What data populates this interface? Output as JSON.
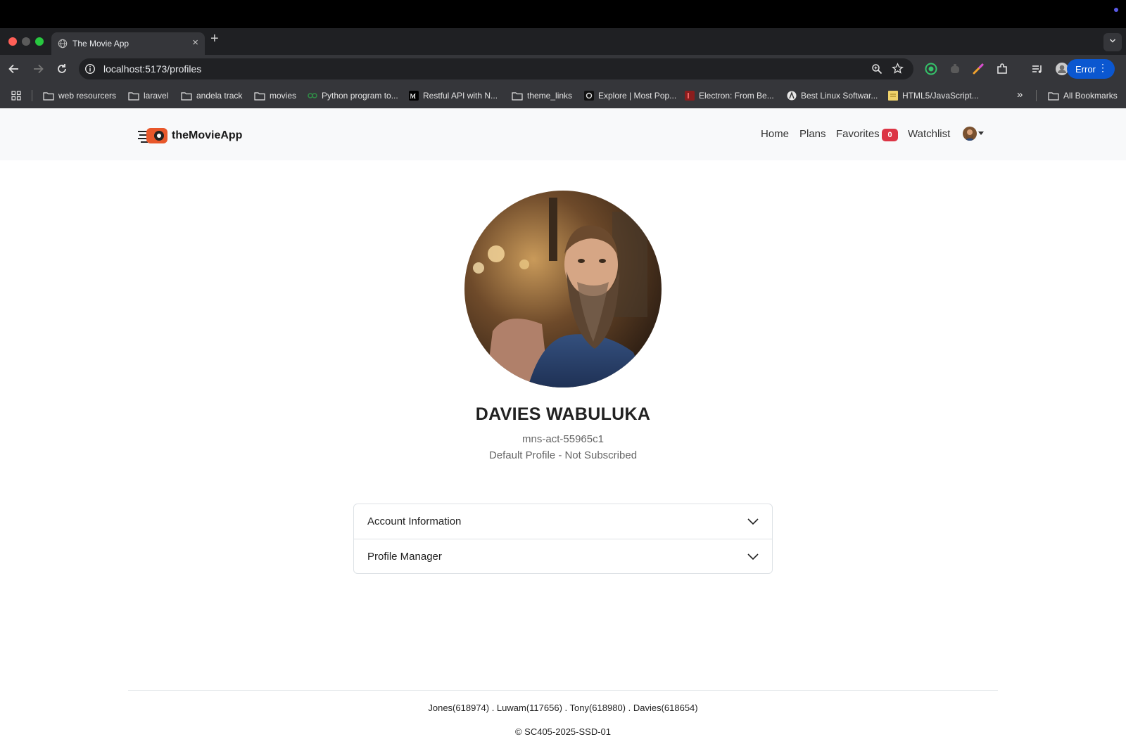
{
  "browser": {
    "tab_title": "The Movie App",
    "new_tab_label": "+",
    "url": "localhost:5173/profiles",
    "error_label": "Error",
    "bookmarks": [
      {
        "label": "web resourcers",
        "icon": "folder-icon"
      },
      {
        "label": "laravel",
        "icon": "folder-icon"
      },
      {
        "label": "andela track",
        "icon": "folder-icon"
      },
      {
        "label": "movies",
        "icon": "folder-icon"
      },
      {
        "label": "Python program to...",
        "icon": "gfg-icon"
      },
      {
        "label": "Restful API with N...",
        "icon": "medium-icon"
      },
      {
        "label": "theme_links",
        "icon": "folder-icon"
      },
      {
        "label": "Explore | Most Pop...",
        "icon": "site-icon"
      },
      {
        "label": "Electron: From Be...",
        "icon": "site-icon"
      },
      {
        "label": "Best Linux Softwar...",
        "icon": "site-icon"
      },
      {
        "label": "HTML5/JavaScript...",
        "icon": "site-icon"
      }
    ],
    "more_bookmarks": "»",
    "all_bookmarks": "All Bookmarks",
    "colors": {
      "error_button": "#0b57d0",
      "toolbar": "#35363a"
    }
  },
  "app": {
    "brand": "theMovieApp",
    "nav": {
      "home": "Home",
      "plans": "Plans",
      "favorites": "Favorites",
      "favorites_count": "0",
      "watchlist": "Watchlist"
    },
    "profile": {
      "name": "DAVIES WABULUKA",
      "account_id": "mns-act-55965c1",
      "status": "Default Profile - Not Subscribed"
    },
    "accordion": [
      {
        "label": "Account Information",
        "expanded": false
      },
      {
        "label": "Profile Manager",
        "expanded": false
      }
    ],
    "footer": {
      "credits": "Jones(618974) . Luwam(117656) . Tony(618980) . Davies(618654)",
      "copyright": "© SC405-2025-SSD-01"
    },
    "colors": {
      "badge": "#dc3545",
      "logo_accent": "#e8572a"
    }
  }
}
